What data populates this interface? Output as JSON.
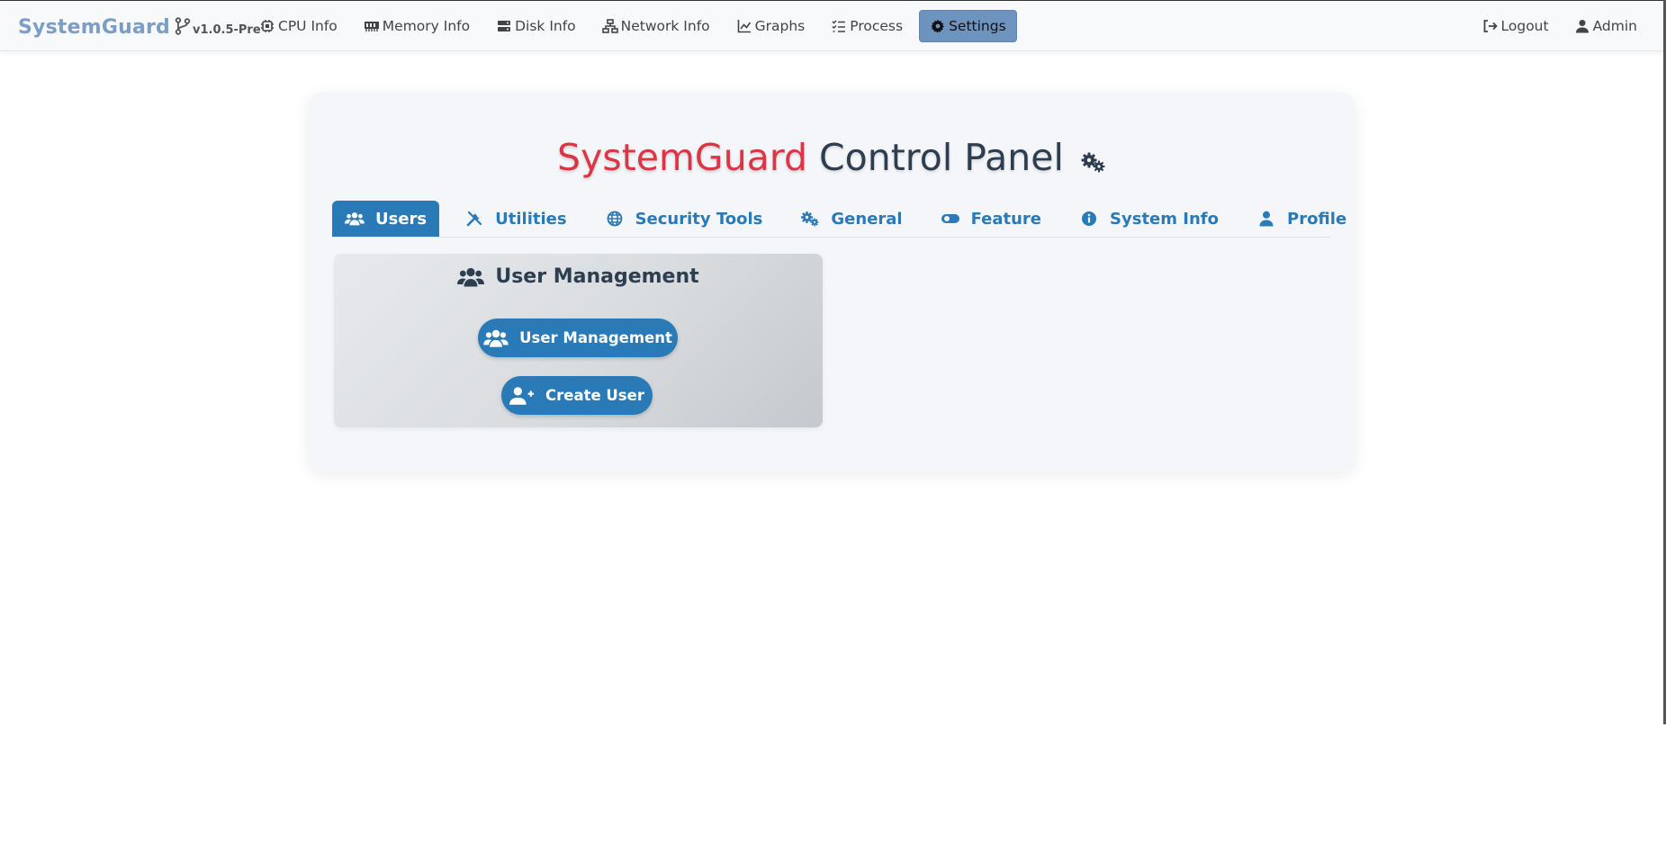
{
  "brand": {
    "name": "SystemGuard",
    "version": "v1.0.5-Pre"
  },
  "nav": {
    "items": [
      {
        "label": "CPU Info",
        "icon": "cpu-icon"
      },
      {
        "label": "Memory Info",
        "icon": "memory-icon"
      },
      {
        "label": "Disk Info",
        "icon": "disk-icon"
      },
      {
        "label": "Network Info",
        "icon": "network-icon"
      },
      {
        "label": "Graphs",
        "icon": "graph-icon"
      },
      {
        "label": "Process",
        "icon": "tasks-icon"
      },
      {
        "label": "Settings",
        "icon": "gear-icon",
        "active": true
      }
    ],
    "right": [
      {
        "label": "Logout",
        "icon": "logout-icon"
      },
      {
        "label": "Admin",
        "icon": "user-icon"
      }
    ]
  },
  "panel": {
    "title_accent": "SystemGuard",
    "title_rest": "Control Panel",
    "tabs": [
      {
        "label": "Users",
        "icon": "users-icon",
        "active": true
      },
      {
        "label": "Utilities",
        "icon": "tools-icon"
      },
      {
        "label": "Security Tools",
        "icon": "globe-icon"
      },
      {
        "label": "General",
        "icon": "cogs-icon"
      },
      {
        "label": "Feature",
        "icon": "toggle-icon"
      },
      {
        "label": "System Info",
        "icon": "info-icon"
      },
      {
        "label": "Profile",
        "icon": "user-icon"
      }
    ]
  },
  "card": {
    "title": "User Management",
    "buttons": {
      "user_management": "User Management",
      "create_user": "Create User"
    }
  },
  "colors": {
    "primary": "#2a7ab8",
    "accent_red": "#dc3545",
    "brand": "#7b9ec7",
    "active_nav": "#6f93bf",
    "title_dark": "#2c3e50"
  }
}
